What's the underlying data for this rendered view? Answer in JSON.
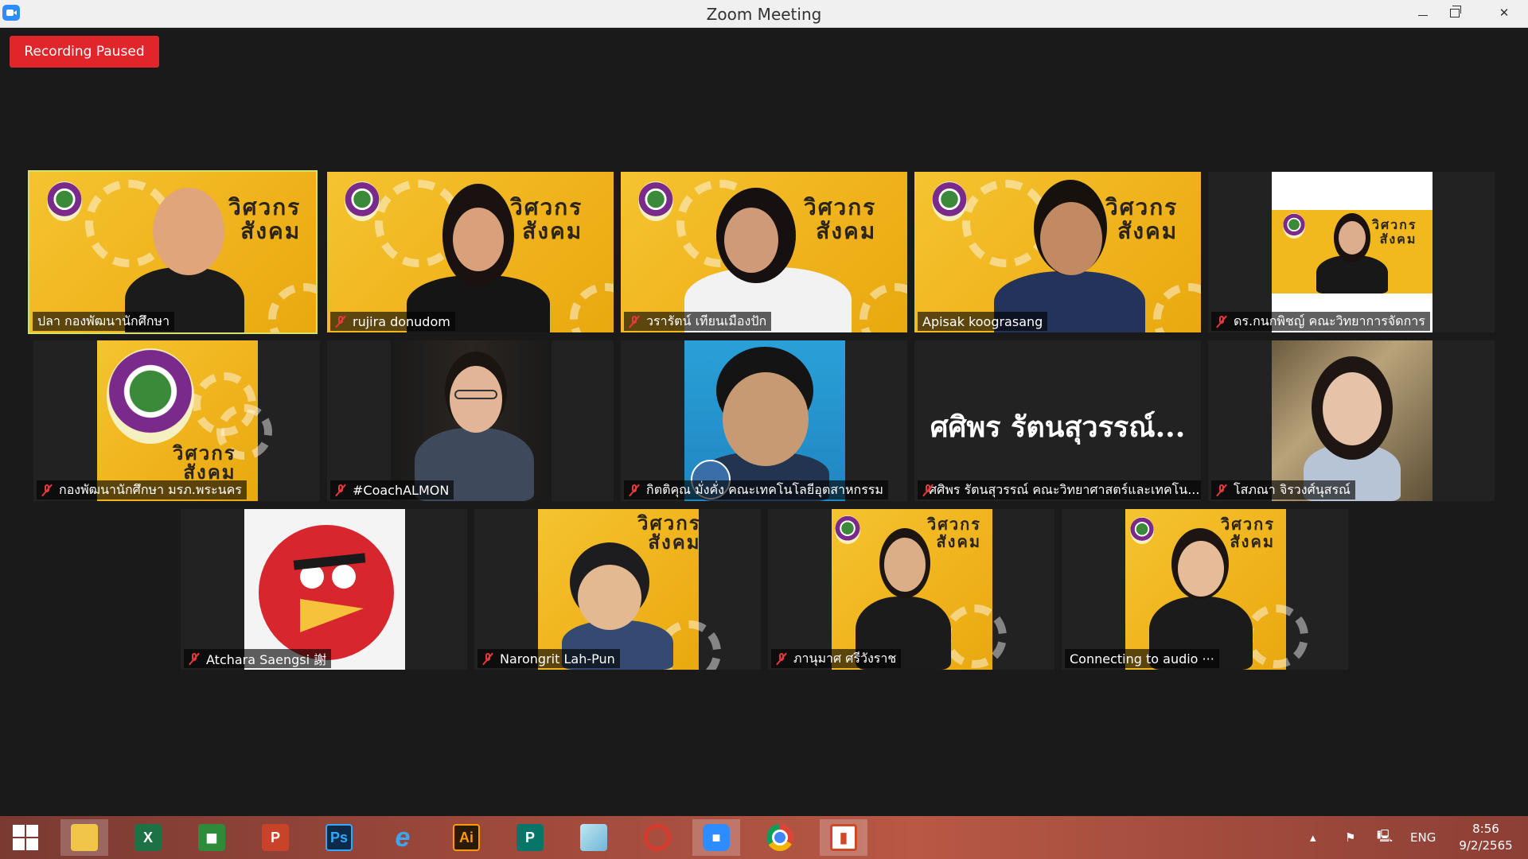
{
  "window": {
    "title": "Zoom Meeting"
  },
  "recording": {
    "label": "Recording Paused"
  },
  "banner": {
    "line1": "วิศวกร",
    "line2": "สังคม"
  },
  "participants": [
    {
      "name": "ปลา กองพัฒนานักศึกษา",
      "muted": false,
      "active": true
    },
    {
      "name": "rujira donudom",
      "muted": true
    },
    {
      "name": "วรารัตน์ เทียนเมืองปัก",
      "muted": true
    },
    {
      "name": "Apisak koograsang",
      "muted": false
    },
    {
      "name": "ดร.กนกพิชญ์ คณะวิทยาการจัดการ",
      "muted": true
    },
    {
      "name": "กองพัฒนานักศึกษา มรภ.พระนคร",
      "muted": true
    },
    {
      "name": "#CoachALMON",
      "muted": true
    },
    {
      "name": "กิตติคุณ มั่งคั่ง คณะเทคโนโลยีอุตสาหกรรม",
      "muted": true
    },
    {
      "name": "ศศิพร รัตนสุวรรณ์ คณะวิทยาศาสตร์และเทคโน...",
      "muted": true,
      "display_name": "ศศิพร รัตนสุวรรณ์..."
    },
    {
      "name": "โสภณา จิรวงศ์นุสรณ์",
      "muted": true
    },
    {
      "name": "Atchara Saengsi 謝",
      "muted": true
    },
    {
      "name": "Narongrit Lah-Pun",
      "muted": true
    },
    {
      "name": "ภานุมาศ ศรีวังราช",
      "muted": true
    },
    {
      "name": "Connecting to audio ···",
      "muted": false
    }
  ],
  "taskbar": {
    "apps": [
      "start-icon",
      "file-explorer-icon",
      "excel-icon",
      "store-icon",
      "powerpoint-icon",
      "photoshop-icon",
      "internet-explorer-icon",
      "illustrator-icon",
      "publisher-icon",
      "eraser-icon",
      "photoscape-icon",
      "zoom-icon",
      "chrome-icon",
      "presentation-icon"
    ],
    "excel_label": "X",
    "powerpoint_label": "P",
    "photoshop_label": "Ps",
    "ie_label": "e",
    "illustrator_label": "Ai",
    "publisher_label": "P",
    "language": "ENG",
    "time": "8:56",
    "date": "9/2/2565"
  },
  "colors": {
    "recording_red": "#e0262b",
    "active_speaker_outline": "#d6e06a",
    "banner_yellow": "#f2b91f"
  }
}
